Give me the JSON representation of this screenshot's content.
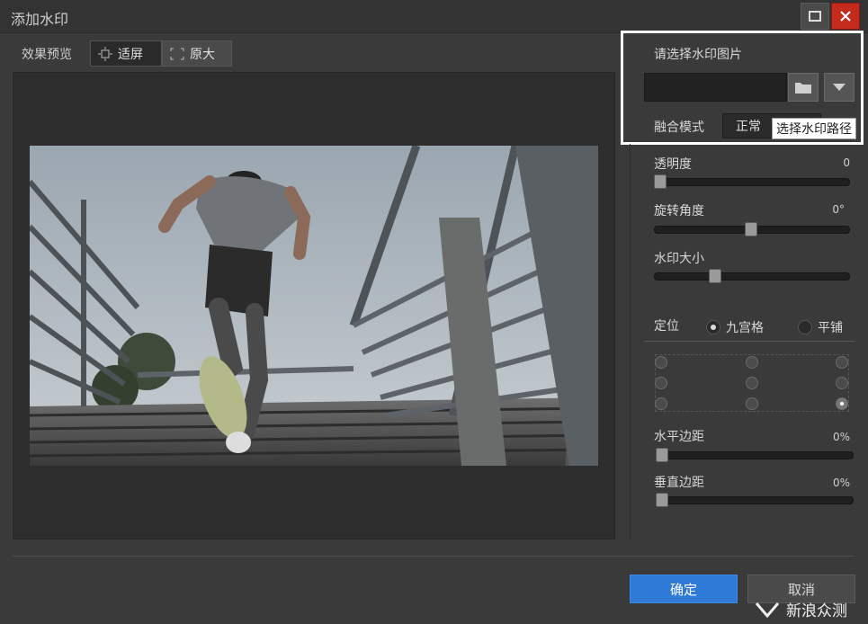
{
  "window": {
    "title": "添加水印"
  },
  "preview": {
    "label": "效果预览",
    "fit_label": "适屏",
    "original_label": "原大"
  },
  "watermark": {
    "choose_label": "请选择水印图片",
    "path_value": "",
    "blend_label": "融合模式",
    "blend_value": "正常",
    "tooltip": "选择水印路径"
  },
  "sliders": [
    {
      "label": "透明度",
      "value": "0",
      "level": 0.0
    },
    {
      "label": "旋转角度",
      "value": "0°",
      "level": 0.5
    },
    {
      "label": "水印大小",
      "value": "",
      "level": 0.3
    },
    {
      "label": "水平边距",
      "value": "0%",
      "level": 0.0
    },
    {
      "label": "垂直边距",
      "value": "0%",
      "level": 0.0
    }
  ],
  "position": {
    "label": "定位",
    "options": [
      "九宫格",
      "平铺"
    ],
    "selected_option": 0,
    "selected_cell": 8
  },
  "buttons": {
    "ok": "确定",
    "cancel": "取消"
  },
  "corner_watermark": "新浪众测",
  "colors": {
    "accent": "#2f7ad6",
    "close": "#c42b1c"
  }
}
